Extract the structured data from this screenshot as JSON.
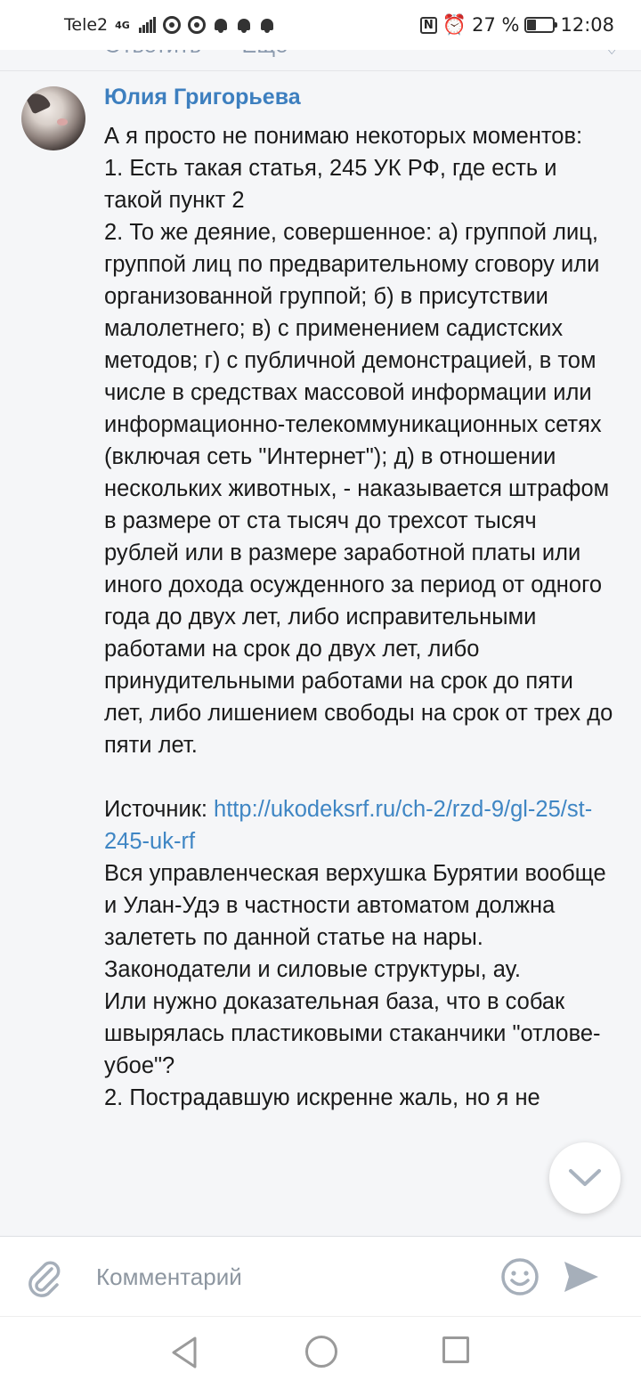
{
  "status_bar": {
    "carrier": "Tele2",
    "network": "4G",
    "battery": "27 %",
    "time": "12:08"
  },
  "previous_comment_actions": {
    "reply": "Ответить",
    "more": "Ещё"
  },
  "comment": {
    "author": "Юлия Григорьева",
    "text_before_link": "А я просто не понимаю некоторых моментов:\n1. Есть такая статья, 245 УК РФ, где есть и такой пункт 2\n2. То же деяние, совершенное: а) группой лиц, группой лиц по предварительному сговору или организованной группой; б) в присутствии малолетнего; в) с применением садистских методов; г) с публичной демонстрацией, в том числе в средствах массовой информации или информационно-телекоммуникационных сетях (включая сеть \"Интернет\"); д) в отношении нескольких животных, - наказывается штрафом в размере от ста тысяч до трехсот тысяч рублей или в размере заработной платы или иного дохода осужденного за период от одного года до двух лет, либо исправительными работами на срок до двух лет, либо принудительными работами на срок до пяти лет, либо лишением свободы на срок от трех до пяти лет.\n\nИсточник: ",
    "link": "http://ukodeksrf.ru/ch-2/rzd-9/gl-25/st-245-uk-rf",
    "text_after_link": "\nВся управленческая верхушка Бурятии вообще и Улан-Удэ в частности автоматом должна залететь по данной статье на нары.\nЗаконодатели и силовые структуры, ау.\nИли нужно доказательная база, что в собак швырялась пластиковыми стаканчики \"отлове-убое\"?\n2. Пострадавшую искренне жаль, но я не"
  },
  "input_bar": {
    "placeholder": "Комментарий"
  },
  "icons": {
    "attach": "paperclip-icon",
    "emoji": "emoji-icon",
    "send": "send-icon",
    "scroll_down": "chevron-down-icon",
    "nav_back": "back-triangle-icon",
    "nav_home": "home-circle-icon",
    "nav_recent": "recents-square-icon"
  },
  "colors": {
    "author": "#3d7fbf",
    "link": "#3f86c4",
    "comment_bg": "#f5f6f8",
    "muted": "#8a99ad"
  }
}
